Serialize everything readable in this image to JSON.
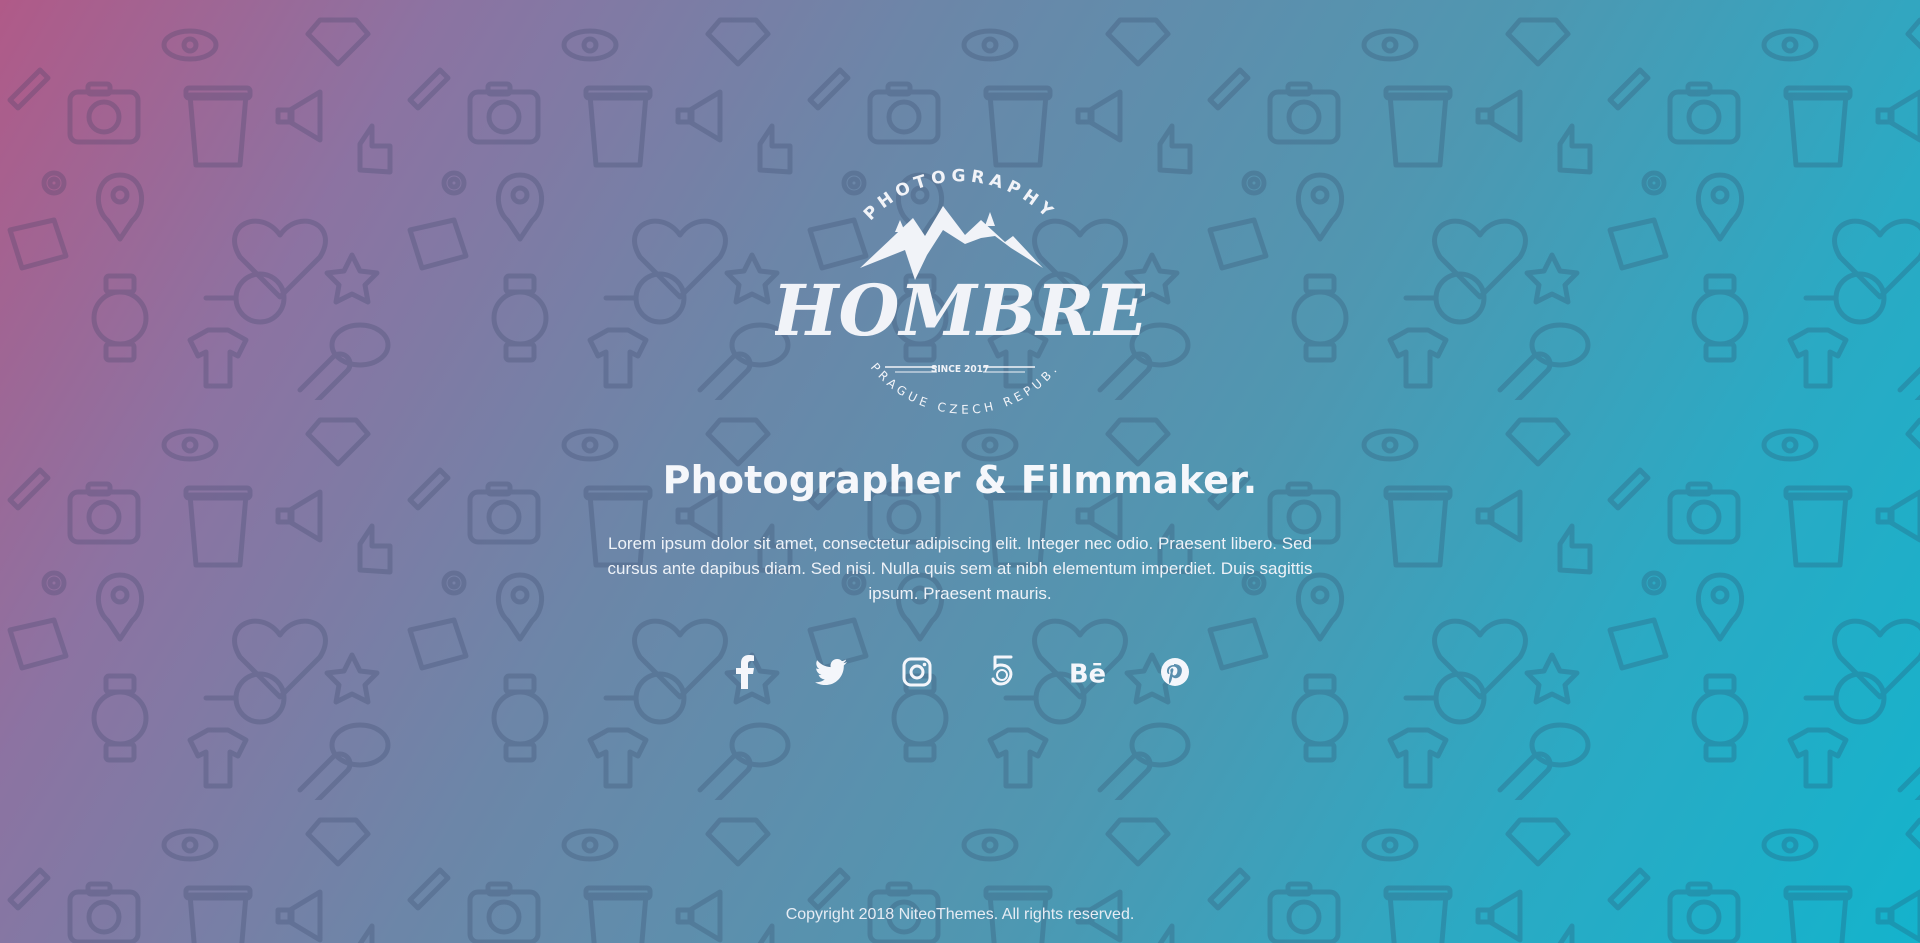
{
  "logo": {
    "top_text": "PHOTOGRAPHY",
    "name": "HOMBRE",
    "since": "SINCE 2017",
    "bottom_text": "· PRAGUE  CZECH REPUB. ·"
  },
  "headline": "Photographer & Filmmaker.",
  "description": "Lorem ipsum dolor sit amet, consectetur adipiscing elit. Integer nec odio. Praesent libero. Sed cursus ante dapibus diam. Sed nisi. Nulla quis sem at nibh elementum imperdiet. Duis sagittis ipsum. Praesent mauris.",
  "social": [
    {
      "icon": "facebook-icon",
      "label": "f"
    },
    {
      "icon": "twitter-icon",
      "label": ""
    },
    {
      "icon": "instagram-icon",
      "label": ""
    },
    {
      "icon": "500px-icon",
      "label": ""
    },
    {
      "icon": "behance-icon",
      "label": "Bē"
    },
    {
      "icon": "pinterest-icon",
      "label": ""
    }
  ],
  "footer": "Copyright 2018 NiteoThemes. All rights reserved.",
  "colors": {
    "gradient_start": "#b05a88",
    "gradient_end": "#14b3cc",
    "text": "#f4f6fb"
  }
}
